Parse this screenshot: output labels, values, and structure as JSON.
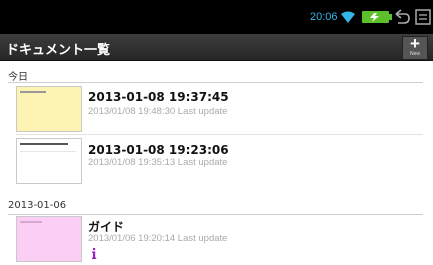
{
  "statusbar": {
    "time": "20:06"
  },
  "appbar": {
    "title": "ドキュメント一覧",
    "new_label": "New",
    "new_symbol": "+"
  },
  "sections": [
    {
      "header": "今日",
      "items": [
        {
          "title": "2013-01-08 19:37:45",
          "subtitle": "2013/01/08 19:48:30 Last update",
          "thumb_color": "#fdf3b3"
        },
        {
          "title": "2013-01-08 19:23:06",
          "subtitle": "2013/01/08 19:35:13 Last update",
          "thumb_color": "#ffffff"
        }
      ]
    },
    {
      "header": "2013-01-06",
      "items": [
        {
          "title": "ガイド",
          "subtitle": "2013/01/06 19:20:14 Last update",
          "thumb_color": "#fbcff5",
          "badge_icon": "info-icon"
        }
      ]
    }
  ],
  "colors": {
    "accent": "#33b5e5",
    "battery": "#5cc02a",
    "info": "#a020c8"
  }
}
